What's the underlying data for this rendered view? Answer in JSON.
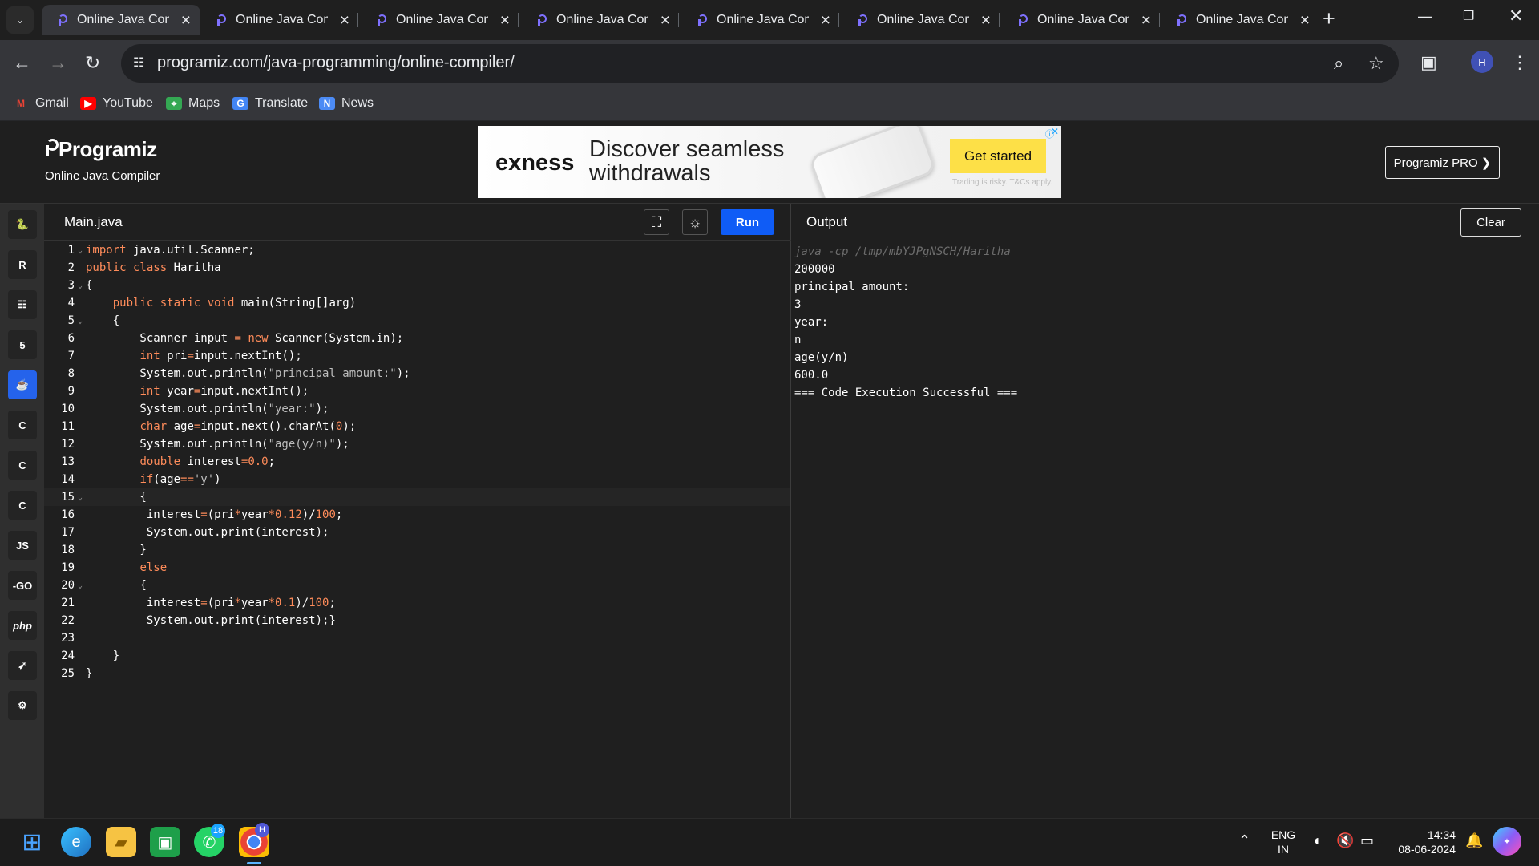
{
  "browser": {
    "tabs": [
      "Online Java Compi",
      "Online Java Compi",
      "Online Java Compi",
      "Online Java Compi",
      "Online Java Compi",
      "Online Java Compi",
      "Online Java Compi",
      "Online Java Compi"
    ],
    "url": "programiz.com/java-programming/online-compiler/",
    "bookmarks": [
      "Gmail",
      "YouTube",
      "Maps",
      "Translate",
      "News"
    ],
    "profile_initial": "H"
  },
  "site": {
    "logo": "Programiz",
    "subtitle": "Online Java Compiler",
    "pro_button": "Programiz PRO ❯"
  },
  "ad": {
    "brand": "exness",
    "headline": "Discover seamless withdrawals",
    "cta": "Get started",
    "disclaimer": "Trading is risky. T&Cs apply."
  },
  "sidebar": {
    "languages": [
      "python",
      "r",
      "sql",
      "html",
      "java",
      "c",
      "cpp",
      "csharp",
      "js",
      "go",
      "php",
      "swift",
      "rust"
    ],
    "labels": [
      "",
      "",
      "",
      "",
      "",
      "",
      "",
      "",
      "JS",
      "-GO",
      "php",
      "",
      ""
    ]
  },
  "editor": {
    "file_name": "Main.java",
    "run_label": "Run",
    "current_line": 15,
    "lines": [
      "import java.util.Scanner;",
      "public class Haritha",
      "{",
      "    public static void main(String[]arg)",
      "    {",
      "        Scanner input = new Scanner(System.in);",
      "        int pri=input.nextInt();",
      "        System.out.println(\"principal amount:\");",
      "        int year=input.nextInt();",
      "        System.out.println(\"year:\");",
      "        char age=input.next().charAt(0);",
      "        System.out.println(\"age(y/n)\");",
      "        double interest=0.0;",
      "        if(age=='y')",
      "        {",
      "         interest=(pri*year*0.12)/100;",
      "         System.out.print(interest);",
      "        }",
      "        else",
      "        {",
      "         interest=(pri*year*0.1)/100;",
      "         System.out.print(interest);}",
      "",
      "    }",
      "}"
    ]
  },
  "output": {
    "title": "Output",
    "clear_label": "Clear",
    "lines": [
      "java -cp /tmp/mbYJPgNSCH/Haritha",
      "200000",
      "principal amount:",
      "3",
      "year:",
      "n",
      "age(y/n)",
      "600.0",
      "=== Code Execution Successful ==="
    ]
  },
  "taskbar": {
    "badge": "18",
    "lang_top": "ENG",
    "lang_bottom": "IN",
    "time": "14:34",
    "date": "08-06-2024"
  }
}
